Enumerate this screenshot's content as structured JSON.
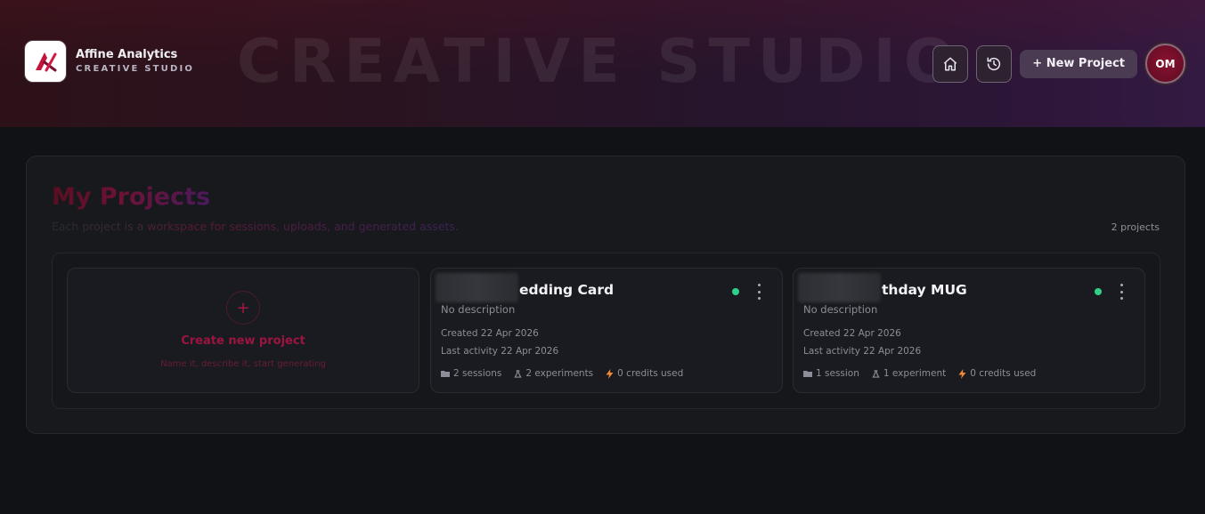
{
  "header": {
    "brand_name": "Affine Analytics",
    "brand_sub": "CREATIVE STUDIO",
    "watermark": "CREATIVE STUDIO",
    "new_project_label": "+ New Project",
    "avatar_initials": "OM",
    "home_icon": "home-icon",
    "history_icon": "history-icon"
  },
  "panel": {
    "title": "My Projects",
    "description": "Each project is a workspace for sessions, uploads, and generated assets.",
    "count": "2 projects"
  },
  "create_card": {
    "title": "Create new project",
    "subtitle": "Name it, describe it, start generating"
  },
  "projects": [
    {
      "title": "edding Card",
      "description": "No description",
      "created": "Created 22 Apr 2026",
      "last_activity": "Last activity 22 Apr 2026",
      "sessions": "2 sessions",
      "experiments": "2 experiments",
      "credits": "0 credits used"
    },
    {
      "title": "thday MUG",
      "description": "No description",
      "created": "Created 22 Apr 2026",
      "last_activity": "Last activity 22 Apr 2026",
      "sessions": "1 session",
      "experiments": "1 experiment",
      "credits": "0 credits used"
    }
  ],
  "colors": {
    "accent": "#9c1540",
    "status_active": "#2fd18a",
    "background": "#111216"
  }
}
